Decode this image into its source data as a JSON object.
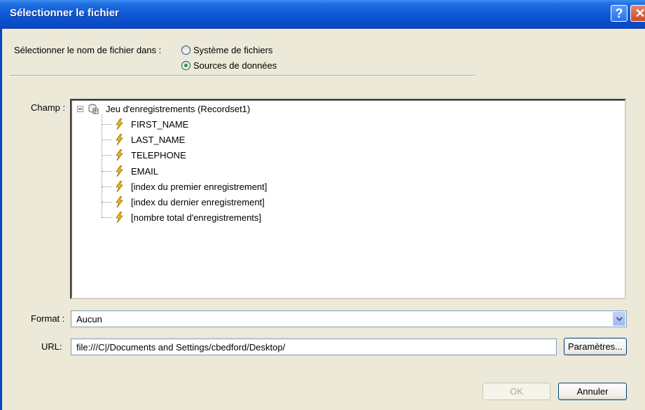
{
  "window": {
    "title": "Sélectionner le fichier",
    "help_glyph": "?",
    "close_glyph": "✕"
  },
  "source": {
    "label": "Sélectionner le nom de fichier dans :",
    "options": [
      {
        "label": "Système de fichiers",
        "checked": false
      },
      {
        "label": "Sources de données",
        "checked": true
      }
    ]
  },
  "field": {
    "label": "Champ :",
    "root": {
      "label": "Jeu d'enregistrements (Recordset1)",
      "icon": "recordset-icon",
      "expanded": true
    },
    "items": [
      "FIRST_NAME",
      "LAST_NAME",
      "TELEPHONE",
      "EMAIL",
      "[index du premier enregistrement]",
      "[index du dernier enregistrement]",
      "[nombre total d'enregistrements]"
    ]
  },
  "format": {
    "label": "Format :",
    "value": "Aucun"
  },
  "url": {
    "label": "URL:",
    "value": "file:///C|/Documents and Settings/cbedford/Desktop/",
    "params_button": "Paramètres..."
  },
  "buttons": {
    "ok": "OK",
    "cancel": "Annuler"
  },
  "colors": {
    "titlebar": "#0A4CC8",
    "dialog_bg": "#ECE9D8",
    "radio_dot": "#21A121",
    "bolt": "#F2C20B"
  }
}
